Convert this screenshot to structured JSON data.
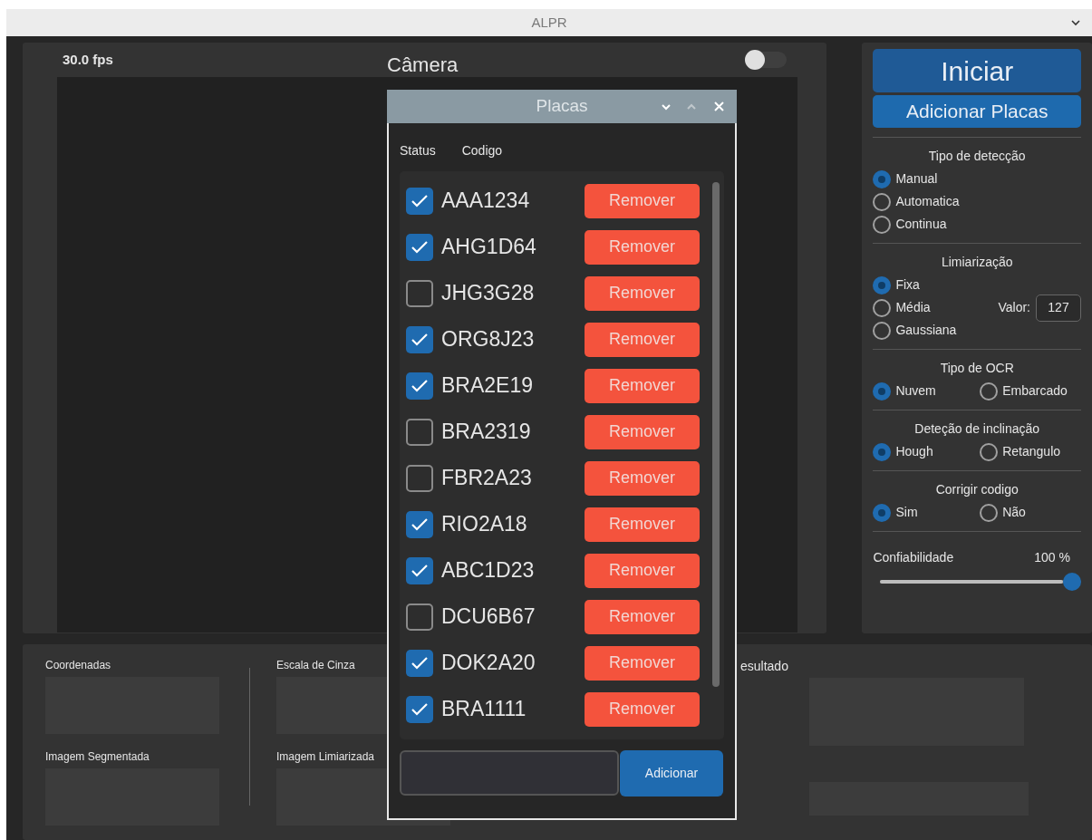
{
  "window": {
    "title": "ALPR"
  },
  "camera": {
    "fps": "30.0 fps",
    "title": "Câmera",
    "toggle_on": false
  },
  "controls": {
    "start_button": "Iniciar",
    "add_plates_button": "Adicionar Placas",
    "groups": [
      {
        "kind": "radio",
        "title": "Tipo de detecção",
        "options": [
          {
            "label": "Manual",
            "selected": true
          },
          {
            "label": "Automatica",
            "selected": false
          },
          {
            "label": "Continua",
            "selected": false
          }
        ]
      },
      {
        "kind": "threshold",
        "title": "Limiarização",
        "options": [
          {
            "label": "Fixa",
            "selected": true
          },
          {
            "label": "Média",
            "selected": false
          },
          {
            "label": "Gaussiana",
            "selected": false
          }
        ],
        "value_label": "Valor:",
        "value": "127"
      },
      {
        "kind": "radio",
        "title": "Tipo de OCR",
        "options": [
          {
            "label": "Nuvem",
            "selected": true
          },
          {
            "label": "Embarcado",
            "selected": false
          }
        ]
      },
      {
        "kind": "radio",
        "title": "Deteção de inclinação",
        "options": [
          {
            "label": "Hough",
            "selected": true
          },
          {
            "label": "Retangulo",
            "selected": false
          }
        ]
      },
      {
        "kind": "radio",
        "title": "Corrigir codigo",
        "options": [
          {
            "label": "Sim",
            "selected": true
          },
          {
            "label": "Não",
            "selected": false
          }
        ]
      },
      {
        "kind": "slider",
        "title": "Confiabilidade",
        "reading": "100 %",
        "level": 1.0
      }
    ]
  },
  "results": {
    "left": [
      {
        "label": "Coordenadas"
      },
      {
        "label": "Imagem Segmentada"
      }
    ],
    "middle": [
      {
        "label": "Escala de Cinza"
      },
      {
        "label": "Imagem Limiarizada"
      }
    ],
    "right_label": "esultado"
  },
  "dialog": {
    "title": "Placas",
    "columns": [
      "Status",
      "Codigo"
    ],
    "rows": [
      {
        "code": "AAA1234",
        "checked": true,
        "button": "Remover"
      },
      {
        "code": "AHG1D64",
        "checked": true,
        "button": "Remover"
      },
      {
        "code": "JHG3G28",
        "checked": false,
        "button": "Remover"
      },
      {
        "code": "ORG8J23",
        "checked": true,
        "button": "Remover"
      },
      {
        "code": "BRA2E19",
        "checked": true,
        "button": "Remover"
      },
      {
        "code": "BRA2319",
        "checked": false,
        "button": "Remover"
      },
      {
        "code": "FBR2A23",
        "checked": false,
        "button": "Remover"
      },
      {
        "code": "RIO2A18",
        "checked": true,
        "button": "Remover"
      },
      {
        "code": "ABC1D23",
        "checked": true,
        "button": "Remover"
      },
      {
        "code": "DCU6B67",
        "checked": false,
        "button": "Remover"
      },
      {
        "code": "DOK2A20",
        "checked": true,
        "button": "Remover"
      },
      {
        "code": "BRA1111",
        "checked": true,
        "button": "Remover"
      }
    ],
    "add_button": "Adicionar"
  }
}
